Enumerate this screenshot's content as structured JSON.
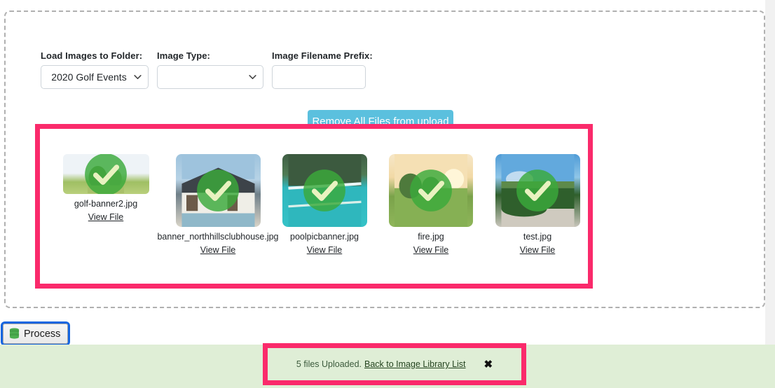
{
  "form": {
    "folder": {
      "label": "Load Images to Folder:",
      "value": "2020 Golf Events",
      "options": [
        "2020 Golf Events"
      ]
    },
    "image_type": {
      "label": "Image Type:",
      "value": "",
      "options": [
        ""
      ]
    },
    "filename_prefix": {
      "label": "Image Filename Prefix:",
      "value": "",
      "placeholder": ""
    }
  },
  "toolbar": {
    "remove_all_label": "Remove All Files from upload",
    "remove_all_color": "#5bc0de"
  },
  "preview": {
    "highlight_color": "#fa2a6b",
    "check_icon": "green-check-icon",
    "view_file_label": "View File",
    "files": [
      {
        "name": "golf-banner2.jpg",
        "view_label": "View File"
      },
      {
        "name": "banner_northhillsclubhouse.jpg",
        "view_label": "View File"
      },
      {
        "name": "poolpicbanner.jpg",
        "view_label": "View File"
      },
      {
        "name": "fire.jpg",
        "view_label": "View File"
      },
      {
        "name": "test.jpg",
        "view_label": "View File"
      }
    ]
  },
  "process": {
    "label": "Process",
    "icon": "database-stack-icon",
    "icon_color": "#4caf50",
    "focus_ring_color": "#1565e0"
  },
  "alert": {
    "message": "5 files Uploaded.",
    "link_label": "Back to Image Library List",
    "close_label": "✖",
    "background_color": "#dfeed6",
    "highlight_color": "#fa2a6b"
  }
}
